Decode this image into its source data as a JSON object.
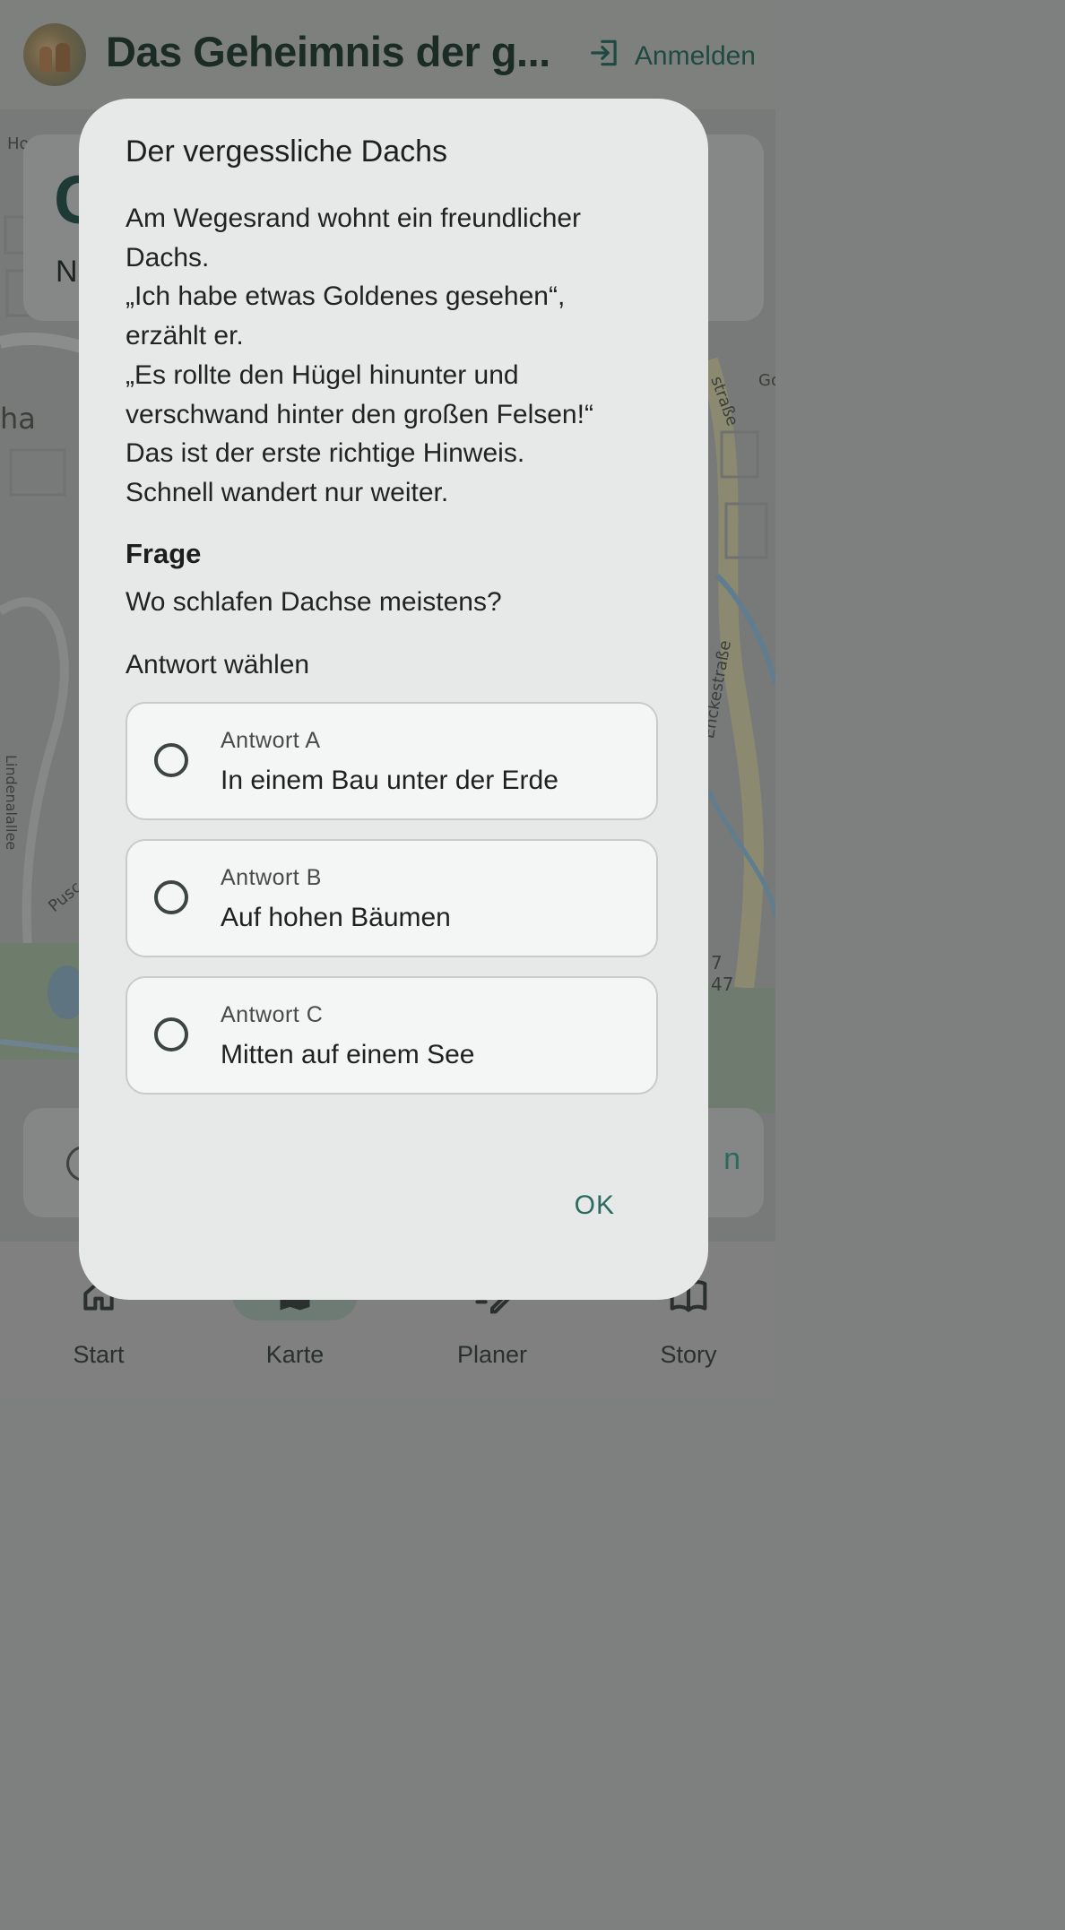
{
  "app": {
    "title": "Das Geheimnis der g...",
    "login_label": "Anmelden"
  },
  "map": {
    "card_top_big": "C",
    "card_top_small": "N",
    "labels": [
      "Ho",
      "ha",
      "Enckestraße",
      "Lindenalallee",
      "Pusc",
      "straße",
      "Go",
      "7",
      "47",
      "n"
    ]
  },
  "dialog": {
    "title": "Der vergessliche Dachs",
    "body": "Am Wegesrand wohnt ein freundlicher\nDachs.\n„Ich habe etwas Goldenes gesehen“,\nerzählt er.\n„Es rollte den Hügel hinunter und\nverschwand hinter den großen Felsen!“\nDas ist der erste richtige Hinweis.\nSchnell wandert nur weiter.",
    "question_heading": "Frage",
    "question": "Wo schlafen Dachse meistens?",
    "choose_label": "Antwort wählen",
    "options": [
      {
        "label": "Antwort A",
        "value": "In einem Bau unter der Erde"
      },
      {
        "label": "Antwort B",
        "value": "Auf hohen Bäumen"
      },
      {
        "label": "Antwort C",
        "value": "Mitten auf einem See"
      }
    ],
    "ok_label": "OK"
  },
  "nav": {
    "items": [
      {
        "label": "Start",
        "icon": "home-icon"
      },
      {
        "label": "Karte",
        "icon": "map-icon",
        "active": true
      },
      {
        "label": "Planer",
        "icon": "edit-list-icon"
      },
      {
        "label": "Story",
        "icon": "book-icon"
      }
    ]
  },
  "colors": {
    "accent": "#2b6b5f",
    "dialog_bg": "#e6e9e8",
    "scrim": "#7d807e"
  }
}
